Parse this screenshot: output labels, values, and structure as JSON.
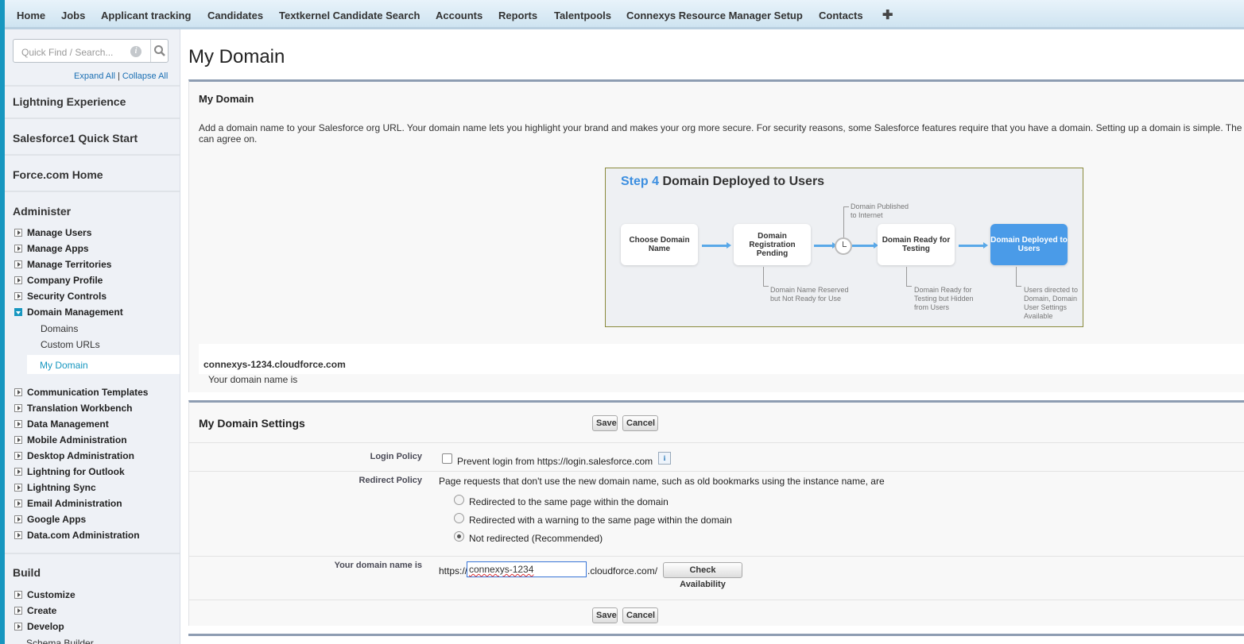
{
  "nav": {
    "tabs": [
      "Home",
      "Jobs",
      "Applicant tracking",
      "Candidates",
      "Textkernel Candidate Search",
      "Accounts",
      "Reports",
      "Talentpools",
      "Connexys Resource Manager Setup",
      "Contacts"
    ],
    "plus": "✚"
  },
  "sidebar": {
    "search_placeholder": "Quick Find / Search...",
    "info_glyph": "i",
    "expand_all": "Expand All",
    "separator": "|",
    "collapse_all": "Collapse All",
    "sections": [
      "Lightning Experience",
      "Salesforce1 Quick Start",
      "Force.com Home",
      "Administer",
      "Build"
    ],
    "administer_items": [
      "Manage Users",
      "Manage Apps",
      "Manage Territories",
      "Company Profile",
      "Security Controls",
      "Domain Management"
    ],
    "domain_subitems": [
      "Domains",
      "Custom URLs",
      "My Domain"
    ],
    "more_items": [
      "Communication Templates",
      "Translation Workbench",
      "Data Management",
      "Mobile Administration",
      "Desktop Administration",
      "Lightning for Outlook",
      "Lightning Sync",
      "Email Administration",
      "Google Apps",
      "Data.com Administration"
    ],
    "build_items": [
      "Customize",
      "Create",
      "Develop"
    ],
    "build_sub": "Schema Builder"
  },
  "page": {
    "title": "My Domain",
    "panel_title": "My Domain",
    "description": "Add a domain name to your Salesforce org URL. Your domain name lets you highlight your brand and makes your org more secure. For security reasons, some Salesforce features require that you have a domain. Setting up a domain is simple. The can agree on.",
    "domain_line_prefix": "Your domain name is ",
    "domain_name": "connexys-1234.cloudforce.com"
  },
  "diagram": {
    "step_label": "Step 4",
    "title": "Domain Deployed to Users",
    "steps": [
      "Choose Domain Name",
      "Domain Registration Pending",
      "Domain Ready for Testing",
      "Domain Deployed to Users"
    ],
    "published_note": "Domain Published to Internet",
    "notes": [
      "Domain Name Reserved but Not Ready for Use",
      "Domain Ready for Testing but Hidden from Users",
      "Users directed to Domain, Domain User Settings Available"
    ]
  },
  "settings": {
    "title": "My Domain Settings",
    "save": "Save",
    "cancel": "Cancel",
    "login_policy_label": "Login Policy",
    "login_policy_text": "Prevent login from https://login.salesforce.com",
    "info_glyph": "i",
    "redirect_label": "Redirect Policy",
    "redirect_text": "Page requests that don't use the new domain name, such as old bookmarks using the instance name, are",
    "redirect_options": [
      "Redirected to the same page within the domain",
      "Redirected with a warning to the same page within the domain",
      "Not redirected (Recommended)"
    ],
    "redirect_selected": 2,
    "domain_label": "Your domain name is",
    "domain_prefix": "https://",
    "domain_value": "connexys-1234",
    "domain_suffix": ".cloudforce.com/",
    "check_availability": "Check Availability"
  }
}
